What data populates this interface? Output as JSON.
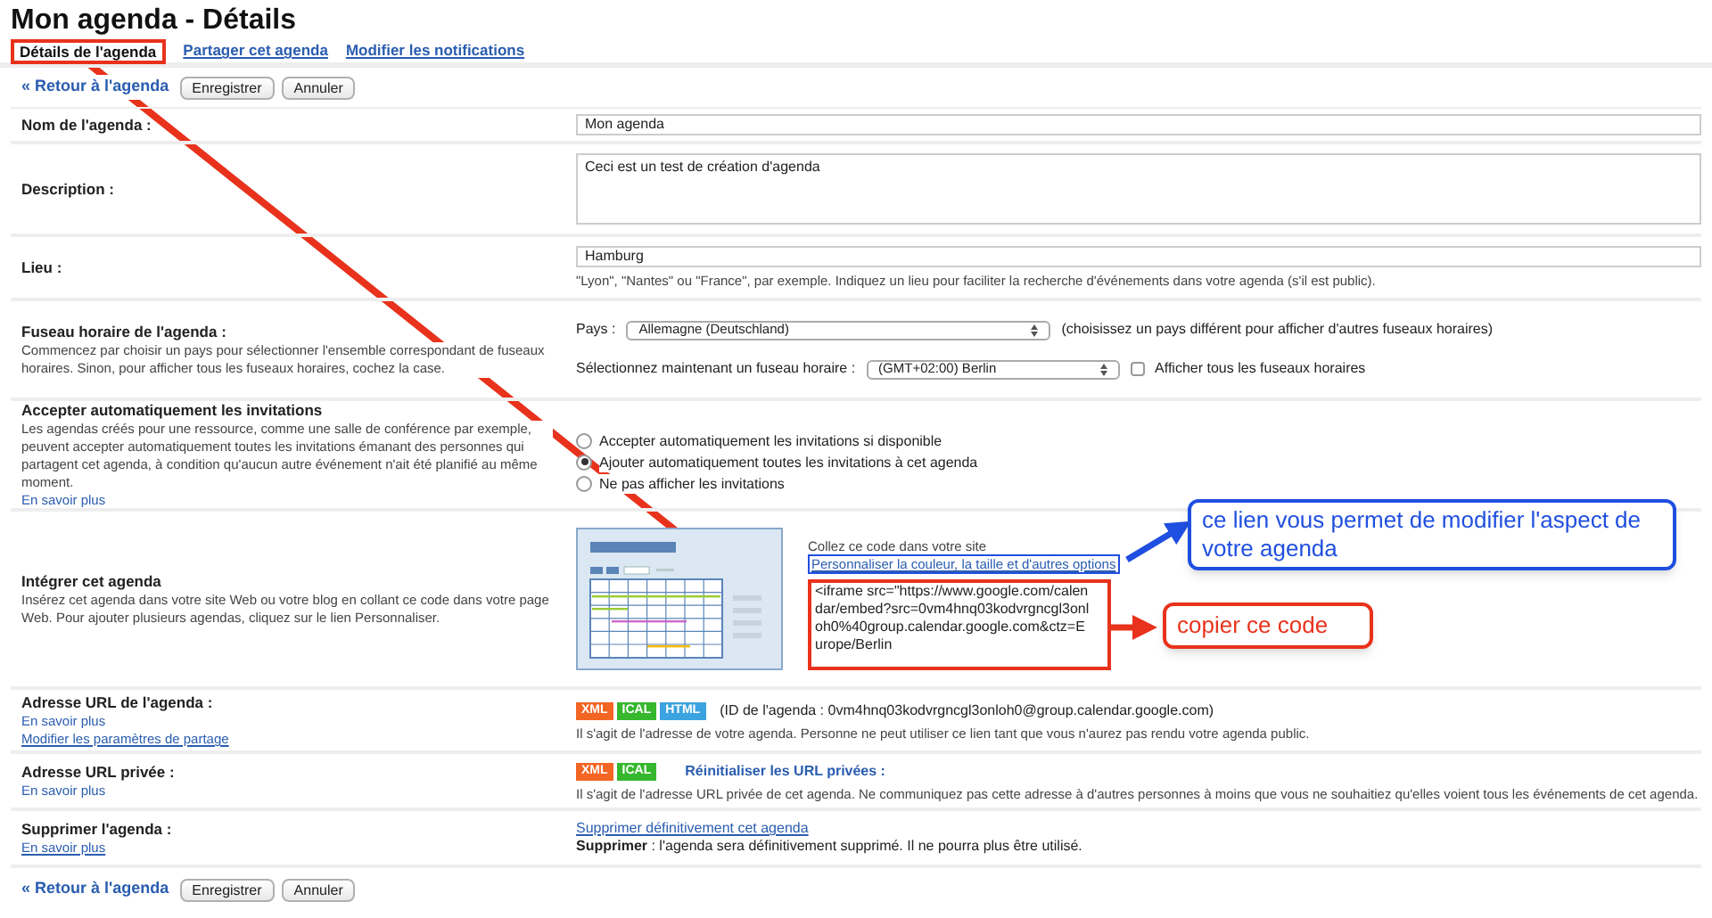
{
  "title": "Mon agenda - Détails",
  "tabs": [
    {
      "label": "Détails de l'agenda",
      "selected": true
    },
    {
      "label": "Partager cet agenda",
      "selected": false
    },
    {
      "label": "Modifier les notifications",
      "selected": false
    }
  ],
  "top_actions": {
    "back_link": "« Retour à l'agenda",
    "buttons": [
      "Enregistrer",
      "Annuler"
    ]
  },
  "rows": [
    {
      "kind": "text",
      "label": "Nom de l'agenda :",
      "value": "Mon agenda"
    },
    {
      "kind": "textarea",
      "label": "Description :",
      "value": "Ceci est un test de création d'agenda"
    },
    {
      "kind": "location",
      "label": "Lieu :",
      "value": "Hamburg",
      "hint": "\"Lyon\", \"Nantes\" ou \"France\", par exemple. Indiquez un lieu pour faciliter la recherche d'événements dans votre agenda (s'il est public)."
    },
    {
      "kind": "timezone",
      "label": "Fuseau horaire de l'agenda :",
      "description": "Commencez par choisir un pays pour sélectionner l'ensemble correspondant de fuseaux horaires. Sinon, pour afficher tous les fuseaux horaires, cochez la case.",
      "country_label": "Pays :",
      "country": "Allemagne (Deutschland)",
      "country_note": "(choisissez un pays différent pour afficher d'autres fuseaux horaires)",
      "tz_label": "Sélectionnez maintenant un fuseau horaire :",
      "tz": "(GMT+02:00) Berlin",
      "show_all": {
        "label": "Afficher tous les fuseaux horaires",
        "checked": false
      }
    },
    {
      "kind": "radios",
      "label": "Accepter automatiquement les invitations",
      "description": "Les agendas créés pour une ressource, comme une salle de conférence par exemple, peuvent accepter automatiquement toutes les invitations émanant des personnes qui partagent cet agenda, à condition qu'aucun autre événement n'ait été planifié au même moment.",
      "links": [
        "En savoir plus"
      ],
      "options": [
        {
          "label": "Accepter automatiquement les invitations si disponible",
          "selected": false
        },
        {
          "label": "Ajouter automatiquement toutes les invitations à cet agenda",
          "selected": true
        },
        {
          "label": "Ne pas afficher les invitations",
          "selected": false
        }
      ]
    },
    {
      "kind": "embed",
      "label": "Intégrer cet agenda",
      "description": "Insérez cet agenda dans votre site Web ou votre blog en collant ce code dans votre page Web. Pour ajouter plusieurs agendas, cliquez sur le lien Personnaliser.",
      "intro": "Collez ce code dans votre site",
      "customize_link": "Personnaliser la couleur, la taille et d'autres options",
      "code": "<iframe src=\"https://www.google.com/calendar/embed?src=0vm4hnq03kodvrgncgl3onloh0%40group.calendar.google.com&ctz=Europe/Berlin"
    },
    {
      "kind": "url",
      "label": "Adresse URL de l'agenda :",
      "links": [
        "En savoir plus",
        "Modifier les paramètres de partage"
      ],
      "badges": [
        {
          "label": "XML",
          "color": "#f26522"
        },
        {
          "label": "ICAL",
          "color": "#36b72e"
        },
        {
          "label": "HTML",
          "color": "#3ba3e0"
        }
      ],
      "id_text": "(ID de l'agenda : 0vm4hnq03kodvrgncgl3onloh0@group.calendar.google.com)",
      "note": "Il s'agit de l'adresse de votre agenda. Personne ne peut utiliser ce lien tant que vous n'aurez pas rendu votre agenda public."
    },
    {
      "kind": "private_url",
      "label": "Adresse URL privée :",
      "links": [
        "En savoir plus"
      ],
      "badges": [
        {
          "label": "XML",
          "color": "#f26522"
        },
        {
          "label": "ICAL",
          "color": "#36b72e"
        }
      ],
      "reset_link": "Réinitialiser les URL privées :",
      "note": "Il s'agit de l'adresse URL privée de cet agenda. Ne communiquez pas cette adresse à d'autres personnes à moins que vous ne souhaitiez qu'elles voient tous les événements de cet agenda."
    },
    {
      "kind": "delete",
      "label": "Supprimer l'agenda :",
      "links": [
        "En savoir plus"
      ],
      "delete_link": "Supprimer définitivement cet agenda",
      "note": "**Supprimer** : l'agenda sera définitivement supprimé. Il ne pourra plus être utilisé."
    }
  ],
  "bottom_actions": {
    "back_link": "« Retour à l'agenda",
    "buttons": [
      "Enregistrer",
      "Annuler"
    ]
  },
  "annotations": [
    {
      "kind": "blue",
      "text": "ce lien vous permet de modifier l'aspect de votre agenda"
    },
    {
      "kind": "red",
      "text": "copier ce code"
    }
  ]
}
